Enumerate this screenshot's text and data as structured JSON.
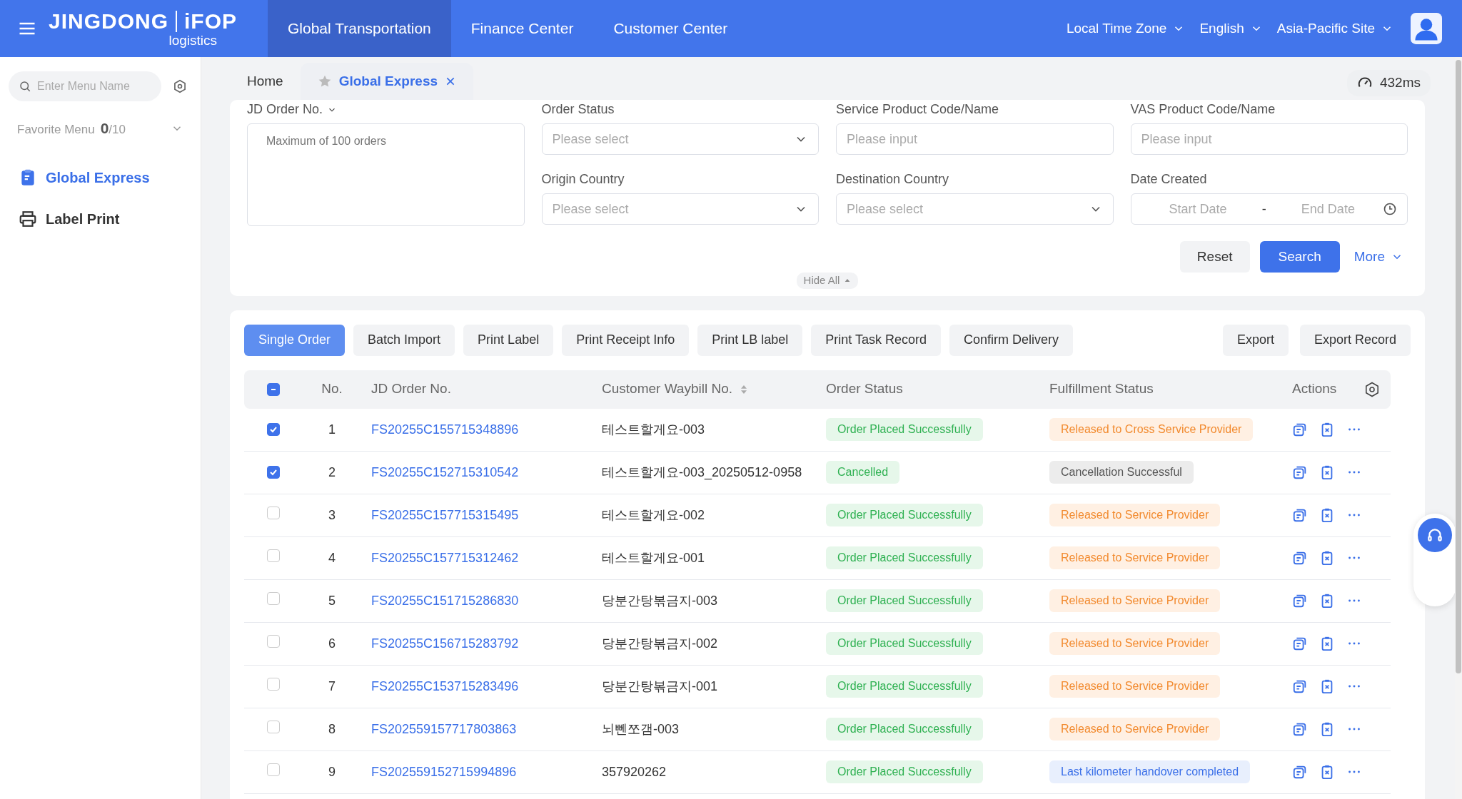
{
  "topbar": {
    "logo": "JINGDONG",
    "logo_product": "iFOP",
    "logo_sub": "logistics",
    "nav": [
      {
        "label": "Global Transportation",
        "selected": true
      },
      {
        "label": "Finance Center",
        "selected": false
      },
      {
        "label": "Customer Center",
        "selected": false
      }
    ],
    "menus": [
      "Local Time Zone",
      "English",
      "Asia-Pacific Site"
    ]
  },
  "sidebar": {
    "search_placeholder": "Enter Menu Name",
    "favorite_label": "Favorite Menu",
    "favorite_count": "0",
    "favorite_max": "/10",
    "items": [
      {
        "label": "Global Express",
        "selected": true,
        "kind": "clipboard"
      },
      {
        "label": "Label Print",
        "selected": false,
        "kind": "printer"
      }
    ]
  },
  "tabs": [
    {
      "label": "Home",
      "selected": false
    },
    {
      "label": "Global Express",
      "selected": true
    }
  ],
  "latency": "432ms",
  "filters": {
    "order_no": {
      "label": "JD Order No.",
      "placeholder": "Maximum of 100 orders"
    },
    "fields": [
      {
        "label": "Order Status",
        "kind": "select",
        "placeholder": "Please select"
      },
      {
        "label": "Service Product Code/Name",
        "kind": "input",
        "placeholder": "Please input"
      },
      {
        "label": "VAS Product Code/Name",
        "kind": "input",
        "placeholder": "Please input"
      },
      {
        "label": "Origin Country",
        "kind": "select",
        "placeholder": "Please select"
      },
      {
        "label": "Destination Country",
        "kind": "select",
        "placeholder": "Please select"
      },
      {
        "label": "Date Created",
        "kind": "daterange",
        "placeholder": "Start Date",
        "placeholder_end": "End Date",
        "separator": "-"
      }
    ],
    "reset": "Reset",
    "search": "Search",
    "more": "More",
    "hide": "Hide All"
  },
  "actions": [
    {
      "label": "Single Order",
      "selected": true
    },
    {
      "label": "Batch Import",
      "selected": false
    },
    {
      "label": "Print Label",
      "selected": false
    },
    {
      "label": "Print Receipt Info",
      "selected": false
    },
    {
      "label": "Print LB label",
      "selected": false
    },
    {
      "label": "Print Task Record",
      "selected": false
    },
    {
      "label": "Confirm Delivery",
      "selected": false
    }
  ],
  "right_actions": [
    "Export",
    "Export Record"
  ],
  "table": {
    "select_all_indeterminate": true,
    "columns": [
      {
        "label": "No."
      },
      {
        "label": "JD Order No."
      },
      {
        "label": "Customer Waybill No.",
        "sortable": true
      },
      {
        "label": "Order Status"
      },
      {
        "label": "Fulfillment Status"
      },
      {
        "label": "Actions"
      }
    ],
    "rows": [
      {
        "checked": true,
        "no": "1",
        "order": "FS20255C155715348896",
        "waybill": "테스트할게요-003",
        "status": {
          "text": "Order Placed Successfully",
          "kind": "success"
        },
        "fulfillment": {
          "text": "Released to Cross Service Provider",
          "kind": "warning"
        }
      },
      {
        "checked": true,
        "no": "2",
        "order": "FS20255C152715310542",
        "waybill": "테스트할게요-003_20250512-0958",
        "status": {
          "text": "Cancelled",
          "kind": "success"
        },
        "fulfillment": {
          "text": "Cancellation Successful",
          "kind": "neutral"
        }
      },
      {
        "checked": false,
        "no": "3",
        "order": "FS20255C157715315495",
        "waybill": "테스트할게요-002",
        "status": {
          "text": "Order Placed Successfully",
          "kind": "success"
        },
        "fulfillment": {
          "text": "Released to Service Provider",
          "kind": "warning"
        }
      },
      {
        "checked": false,
        "no": "4",
        "order": "FS20255C157715312462",
        "waybill": "테스트할게요-001",
        "status": {
          "text": "Order Placed Successfully",
          "kind": "success"
        },
        "fulfillment": {
          "text": "Released to Service Provider",
          "kind": "warning"
        }
      },
      {
        "checked": false,
        "no": "5",
        "order": "FS20255C151715286830",
        "waybill": "당분간탕볶금지-003",
        "status": {
          "text": "Order Placed Successfully",
          "kind": "success"
        },
        "fulfillment": {
          "text": "Released to Service Provider",
          "kind": "warning"
        }
      },
      {
        "checked": false,
        "no": "6",
        "order": "FS20255C156715283792",
        "waybill": "당분간탕볶금지-002",
        "status": {
          "text": "Order Placed Successfully",
          "kind": "success"
        },
        "fulfillment": {
          "text": "Released to Service Provider",
          "kind": "warning"
        }
      },
      {
        "checked": false,
        "no": "7",
        "order": "FS20255C153715283496",
        "waybill": "당분간탕볶금지-001",
        "status": {
          "text": "Order Placed Successfully",
          "kind": "success"
        },
        "fulfillment": {
          "text": "Released to Service Provider",
          "kind": "warning"
        }
      },
      {
        "checked": false,
        "no": "8",
        "order": "FS202559157717803863",
        "waybill": "뇌뻰쪼갬-003",
        "status": {
          "text": "Order Placed Successfully",
          "kind": "success"
        },
        "fulfillment": {
          "text": "Released to Service Provider",
          "kind": "warning"
        }
      },
      {
        "checked": false,
        "no": "9",
        "order": "FS202559152715994896",
        "waybill": "357920262",
        "status": {
          "text": "Order Placed Successfully",
          "kind": "success"
        },
        "fulfillment": {
          "text": "Last kilometer handover completed",
          "kind": "info"
        }
      }
    ]
  }
}
